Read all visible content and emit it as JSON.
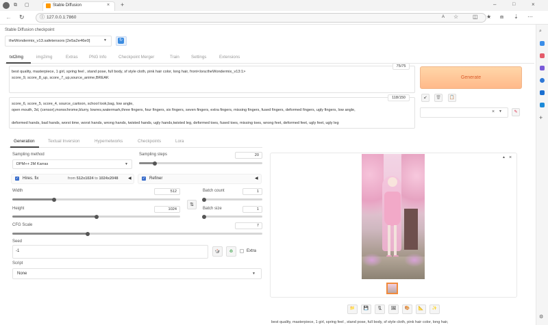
{
  "browser": {
    "tab_title": "Stable Diffusion",
    "url": "127.0.0.1:7860"
  },
  "checkpoint": {
    "label": "Stable Diffusion checkpoint",
    "value": "theWondermix_v13.safetensors [2e5a2e46e0]"
  },
  "main_tabs": [
    "txt2img",
    "img2img",
    "Extras",
    "PNG Info",
    "Checkpoint Merger",
    "Train",
    "Settings",
    "Extensions"
  ],
  "prompt": {
    "line1": "best quality, masterpiece, 1 girl, spring feel , stand pose, full body, sf style cloth, pink hair color, long hair, front<lora:theWondermix_v13:1>",
    "line2": "score_9, score_8_up, score_7_up,source_anime,BREAK",
    "counter": "75/75"
  },
  "negative": {
    "line1": "score_6, score_5, score_4, source_cartoon, school look,bag, low angle,",
    "line2": "open mouth, 3d, (censor),monochrome,blurry, lowres,watermark,three fingers, four fingers, six fingers, seven fingers, extra fingers, missing fingers, fused fingers, deformed fingers, ugly fingers, low angle,",
    "line3": "deformed hands, bad hands, worst time, worst hands, wrong hands, twisted hands, ugly hands,twisted leg, deformed toes, fused toes, missing toes, wrong feet, deformed feet, ugly feet, ugly leg",
    "counter": "118/150"
  },
  "generate_label": "Generate",
  "sub_tabs": [
    "Generation",
    "Textual Inversion",
    "Hypernetworks",
    "Checkpoints",
    "Lora"
  ],
  "sampling": {
    "method_label": "Sampling method",
    "method_value": "DPM++ 2M Karras",
    "steps_label": "Sampling steps",
    "steps": "20",
    "steps_level": 0.13
  },
  "hires": {
    "label": "Hires. fix",
    "from_text": "from",
    "from_val": "512x1024",
    "to_text": "to",
    "to_val": "1024x2048"
  },
  "refiner": {
    "label": "Refiner"
  },
  "width": {
    "label": "Width",
    "value": "512",
    "level": 0.25
  },
  "height": {
    "label": "Height",
    "value": "1024",
    "level": 0.5
  },
  "batch_count": {
    "label": "Batch count",
    "value": "1",
    "level": 0.02
  },
  "batch_size": {
    "label": "Batch size",
    "value": "1",
    "level": 0.02
  },
  "cfg": {
    "label": "CFG Scale",
    "value": "7",
    "level": 0.3
  },
  "seed": {
    "label": "Seed",
    "value": "-1",
    "extra_label": "Extra"
  },
  "script": {
    "label": "Script",
    "value": "None"
  },
  "output_caption": "best quality, masterpiece, 1 girl, spring feel , stand pose, full body, sf style cloth, pink hair color, long hair,",
  "icons": [
    "back-icon",
    "forward-icon",
    "refresh-icon",
    "home-icon",
    "folder-icon",
    "save-icon",
    "zip-icon",
    "image-icon",
    "palette-icon",
    "ruler-icon",
    "star-icon"
  ]
}
